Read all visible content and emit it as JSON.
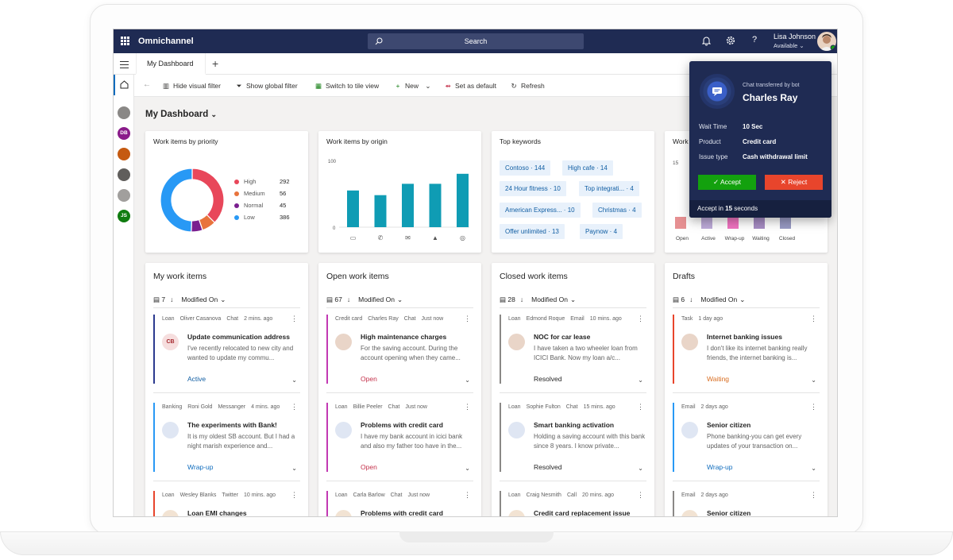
{
  "app": {
    "name": "Omnichannel",
    "search_placeholder": "Search",
    "user_name": "Lisa Johnson",
    "user_status": "Available"
  },
  "tabs": [
    {
      "label": "My Dashboard"
    }
  ],
  "toolbar": {
    "hide_visual_filter": "Hide visual filter",
    "show_global_filter": "Show global filter",
    "switch_tile": "Switch to tile view",
    "new": "New",
    "set_default": "Set as default",
    "refresh": "Refresh"
  },
  "rail": [
    {
      "initials": "",
      "color": "#8a8886"
    },
    {
      "initials": "DB",
      "color": "#8a1b8a"
    },
    {
      "initials": "",
      "color": "#c55a11"
    },
    {
      "initials": "",
      "color": "#605e5c"
    },
    {
      "initials": "",
      "color": "#a19f9d"
    },
    {
      "initials": "JS",
      "color": "#107c10"
    }
  ],
  "dashboard": {
    "title": "My Dashboard"
  },
  "priority": {
    "title": "Work items by priority",
    "chart_data": {
      "type": "pie",
      "labels": [
        "High",
        "Medium",
        "Normal",
        "Low"
      ],
      "values": [
        292,
        56,
        45,
        386
      ],
      "colors": [
        "#e8475a",
        "#e8733c",
        "#7a1f8f",
        "#2899f5"
      ]
    }
  },
  "origin": {
    "title": "Work items by origin",
    "chart_data": {
      "type": "bar",
      "categories": [
        "Chat",
        "Phone",
        "Email",
        "Twitter",
        "Messenger",
        "",
        "",
        ""
      ],
      "values": [
        55,
        48,
        65,
        65,
        80
      ],
      "ylim": [
        0,
        100
      ],
      "ticks": [
        "100",
        "0"
      ],
      "color": "#0f9cb4"
    }
  },
  "keywords": {
    "title": "Top keywords",
    "items": [
      "Contoso · 144",
      "High cafe · 14",
      "24 Hour fitness · 10",
      "Top integrati... · 4",
      "American Express... · 10",
      "Christmas · 4",
      "Offer unlimited · 13",
      "Paynow · 4"
    ]
  },
  "status_chart": {
    "title": "Work",
    "tick": "15",
    "labels": [
      "Open",
      "Active",
      "Wrap-up",
      "Waiting",
      "Closed"
    ]
  },
  "lists": [
    {
      "title": "My work items",
      "count": "7",
      "sort": "Modified On",
      "items": [
        {
          "tag": "Loan",
          "who": "Oliver Casanova",
          "ch": "Chat",
          "time": "2 mins. ago",
          "initials": "CB",
          "subject": "Update communication address",
          "body": "I've recently relocated to new city and wanted to update my commu...",
          "status": "Active",
          "scolor": "#115ea3",
          "bar": "#2b3a8f"
        },
        {
          "tag": "Banking",
          "who": "Roni Gold",
          "ch": "Messanger",
          "time": "4 mins. ago",
          "initials": "",
          "subject": "The experiments with Bank!",
          "body": "It is my oldest SB account. But I had a night marish experience and...",
          "status": "Wrap-up",
          "scolor": "#0f6cbd",
          "bar": "#2899f5"
        },
        {
          "tag": "Loan",
          "who": "Wesley Blanks",
          "ch": "Twitter",
          "time": "10 mins. ago",
          "initials": "",
          "subject": "Loan EMI changes",
          "body": "",
          "status": "",
          "scolor": "#555",
          "bar": "#e8452c"
        }
      ]
    },
    {
      "title": "Open work items",
      "count": "67",
      "sort": "Modified On",
      "items": [
        {
          "tag": "Credit card",
          "who": "Charles Ray",
          "ch": "Chat",
          "time": "Just now",
          "initials": "",
          "subject": "High maintenance charges",
          "body": "For the saving account. During the account opening when they came...",
          "status": "Open",
          "scolor": "#c4314b",
          "bar": "#c239b3"
        },
        {
          "tag": "Loan",
          "who": "Billie Peeler",
          "ch": "Chat",
          "time": "Just now",
          "initials": "",
          "subject": "Problems with credit card",
          "body": "I have my bank account in icici bank and also my father too have in the...",
          "status": "Open",
          "scolor": "#c4314b",
          "bar": "#c239b3"
        },
        {
          "tag": "Loan",
          "who": "Carla Barlow",
          "ch": "Chat",
          "time": "Just now",
          "initials": "",
          "subject": "Problems with credit card",
          "body": "",
          "status": "",
          "scolor": "#555",
          "bar": "#c239b3"
        }
      ]
    },
    {
      "title": "Closed work items",
      "count": "28",
      "sort": "Modified On",
      "items": [
        {
          "tag": "Loan",
          "who": "Edmond Roque",
          "ch": "Email",
          "time": "10 mins. ago",
          "initials": "",
          "subject": "NOC for car lease",
          "body": "I have taken a two wheeler loan from ICICI Bank. Now my loan a/c...",
          "status": "Resolved",
          "scolor": "#242424",
          "bar": "#8a8886"
        },
        {
          "tag": "Loan",
          "who": "Sophie Fulton",
          "ch": "Chat",
          "time": "15 mins. ago",
          "initials": "",
          "subject": "Smart banking activation",
          "body": "Holding a saving account with this bank since 8 years. I know private...",
          "status": "Resolved",
          "scolor": "#242424",
          "bar": "#8a8886"
        },
        {
          "tag": "Loan",
          "who": "Craig Nesmith",
          "ch": "Call",
          "time": "20 mins. ago",
          "initials": "",
          "subject": "Credit card replacement issue",
          "body": "",
          "status": "",
          "scolor": "#555",
          "bar": "#8a8886"
        }
      ]
    },
    {
      "title": "Drafts",
      "count": "6",
      "sort": "Modified On",
      "items": [
        {
          "tag": "Task",
          "who": "",
          "ch": "",
          "time": "1 day ago",
          "initials": "",
          "subject": "Internet banking issues",
          "body": "I don't like its internet banking really friends, the internet banking is...",
          "status": "Waiting",
          "scolor": "#d86c1f",
          "bar": "#e8452c"
        },
        {
          "tag": "Email",
          "who": "",
          "ch": "",
          "time": "2 days ago",
          "initials": "",
          "subject": "Senior citizen",
          "body": "Phone banking-you can get every updates of your transaction on...",
          "status": "Wrap-up",
          "scolor": "#0f6cbd",
          "bar": "#2899f5"
        },
        {
          "tag": "Email",
          "who": "",
          "ch": "",
          "time": "2 days ago",
          "initials": "",
          "subject": "Senior citizen",
          "body": "",
          "status": "",
          "scolor": "#555",
          "bar": "#8a8886"
        }
      ]
    }
  ],
  "popup": {
    "subtitle": "Chat transferred by bot",
    "name": "Charles Ray",
    "rows": [
      {
        "label": "Wait Time",
        "value": "10 Sec"
      },
      {
        "label": "Product",
        "value": "Credit card"
      },
      {
        "label": "Issue type",
        "value": "Cash withdrawal limit"
      }
    ],
    "accept": "Accept",
    "reject": "Reject",
    "footer_prefix": "Accept in",
    "footer_num": "15",
    "footer_suffix": "seconds"
  }
}
